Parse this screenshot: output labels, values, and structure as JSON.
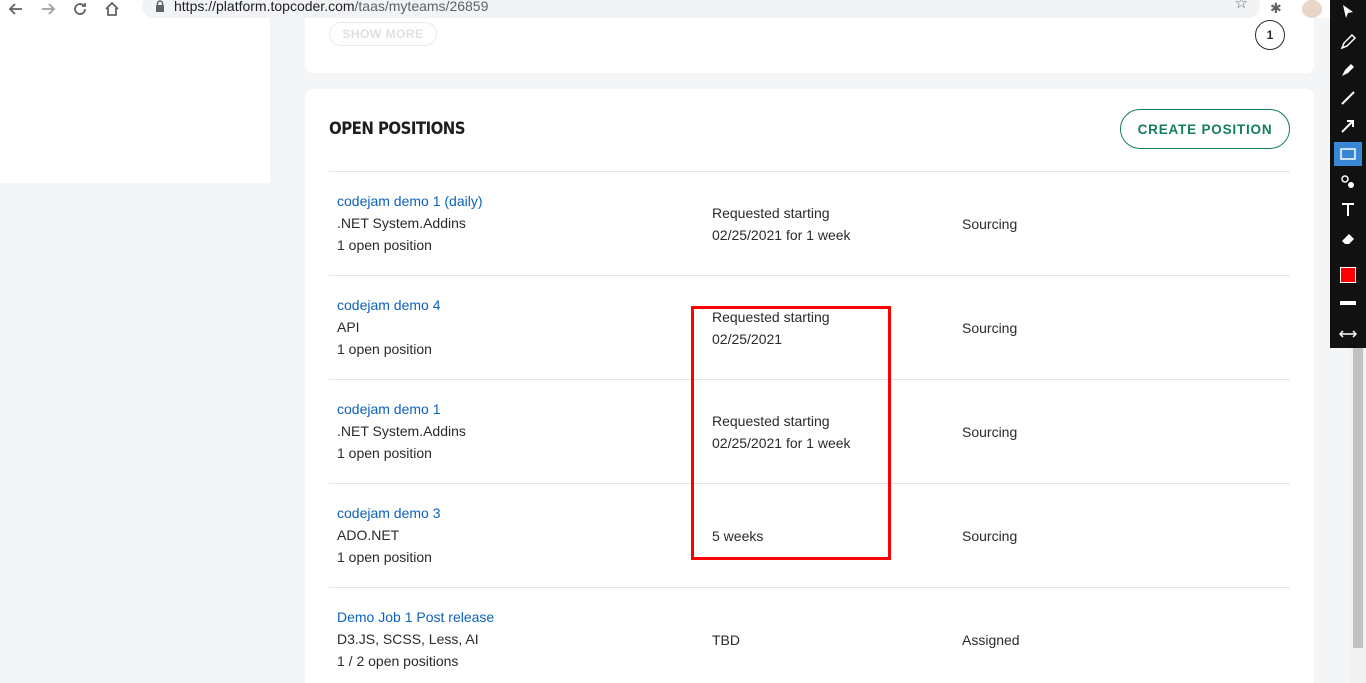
{
  "browser": {
    "url_host": "https://platform.topcoder.com",
    "url_path": "/taas/myteams/26859"
  },
  "top_card": {
    "show_more_label": "SHOW MORE",
    "page_number": "1"
  },
  "open_positions": {
    "title": "OPEN POSITIONS",
    "create_button_label": "CREATE POSITION",
    "rows": [
      {
        "title": "codejam demo 1 (daily)",
        "skills": ".NET System.Addins",
        "count": "1 open position",
        "date_line1": "Requested starting",
        "date_line2": "02/25/2021 for 1 week",
        "status": "Sourcing"
      },
      {
        "title": "codejam demo 4",
        "skills": "API",
        "count": "1 open position",
        "date_line1": "Requested starting",
        "date_line2": "02/25/2021",
        "status": "Sourcing"
      },
      {
        "title": "codejam demo 1",
        "skills": ".NET System.Addins",
        "count": "1 open position",
        "date_line1": "Requested starting",
        "date_line2": "02/25/2021 for 1 week",
        "status": "Sourcing"
      },
      {
        "title": "codejam demo 3",
        "skills": "ADO.NET",
        "count": "1 open position",
        "date_line1": "",
        "date_line2": "5 weeks",
        "status": "Sourcing"
      },
      {
        "title": "Demo Job 1 Post release",
        "skills": "D3.JS, SCSS, Less, AI",
        "count": "1 / 2 open positions",
        "date_line1": "",
        "date_line2": "TBD",
        "status": "Assigned"
      }
    ]
  },
  "annotation": {
    "color": "#ff0000"
  },
  "toolbar_icons": [
    "cursor-icon",
    "pencil-icon",
    "highlighter-icon",
    "line-icon",
    "arrow-icon",
    "rectangle-icon",
    "stamp-icon",
    "text-icon",
    "eraser-icon",
    "color-swatch",
    "line-width",
    "collapse-icon"
  ]
}
